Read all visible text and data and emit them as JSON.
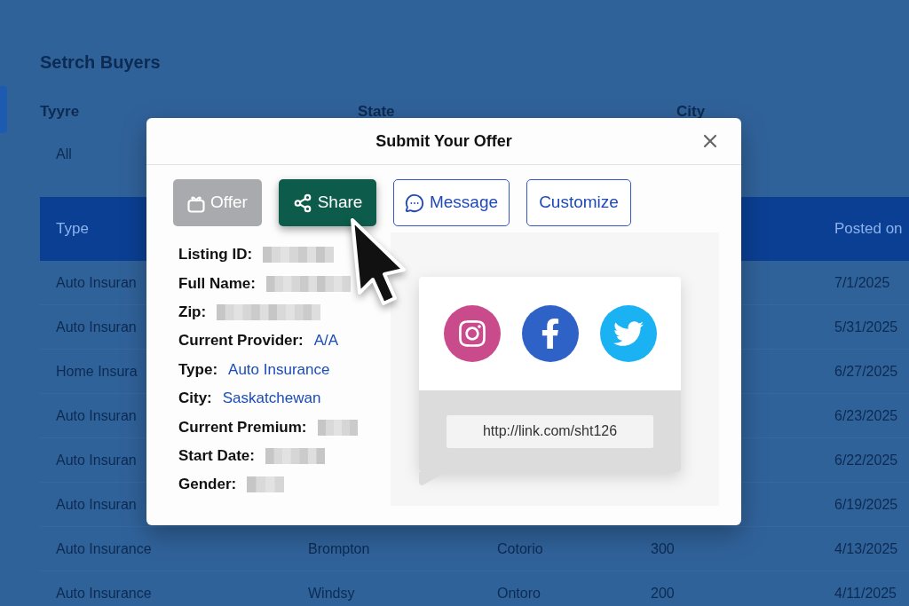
{
  "background": {
    "title": "Setrch Buyers",
    "filters": [
      {
        "label": "Tyyre",
        "value": "All"
      },
      {
        "label": "State"
      },
      {
        "label": "City"
      }
    ],
    "table": {
      "header": {
        "type": "Type",
        "posted_on": "Posted on"
      },
      "rows": [
        {
          "type": "Auto Insuran",
          "posted_on": "7/1/2025"
        },
        {
          "type": "Auto Insuran",
          "posted_on": "5/31/2025"
        },
        {
          "type": "Home Insura",
          "posted_on": "6/27/2025"
        },
        {
          "type": "Auto Insuran",
          "posted_on": "6/23/2025"
        },
        {
          "type": "Auto Insuran",
          "posted_on": "6/22/2025"
        },
        {
          "type": "Auto Insuran",
          "posted_on": "6/19/2025"
        },
        {
          "type": "Auto Insurance",
          "column_2": "Brompton",
          "column_3": "Cotorio",
          "column_4": "300",
          "posted_on": "4/13/2025"
        },
        {
          "type": "Auto Insurance",
          "column_2": "Windsy",
          "column_3": "Ontoro",
          "column_4": "200",
          "posted_on": "4/11/2025"
        }
      ]
    }
  },
  "modal": {
    "title": "Submit Your Offer",
    "actions": [
      {
        "label": "Offer",
        "selected": false,
        "disabled": true
      },
      {
        "label": "Share",
        "selected": true,
        "disabled": false
      },
      {
        "label": "Message",
        "selected": false,
        "disabled": false
      },
      {
        "label": "Customize",
        "selected": false,
        "disabled": false
      }
    ],
    "details": [
      {
        "label": "Listing ID:",
        "kind": "redacted"
      },
      {
        "label": "Full Name:",
        "kind": "redacted"
      },
      {
        "label": "Zip:",
        "kind": "redacted"
      },
      {
        "label": "Current Provider:",
        "kind": "text",
        "value": "A/A"
      },
      {
        "label": "Type:",
        "kind": "text",
        "value": "Auto Insurance"
      },
      {
        "label": "City:",
        "kind": "text",
        "value": "Saskatchewan"
      },
      {
        "label": "Current Premium:",
        "kind": "redacted"
      },
      {
        "label": "Start Date:",
        "kind": "redacted"
      },
      {
        "label": "Gender:",
        "kind": "redacted"
      }
    ],
    "share_targets": [
      {
        "color": "#c94b8c"
      },
      {
        "color": "#2e62c6"
      },
      {
        "color": "#1ab2f2"
      }
    ],
    "share_link": "http://link.com/sht126"
  }
}
